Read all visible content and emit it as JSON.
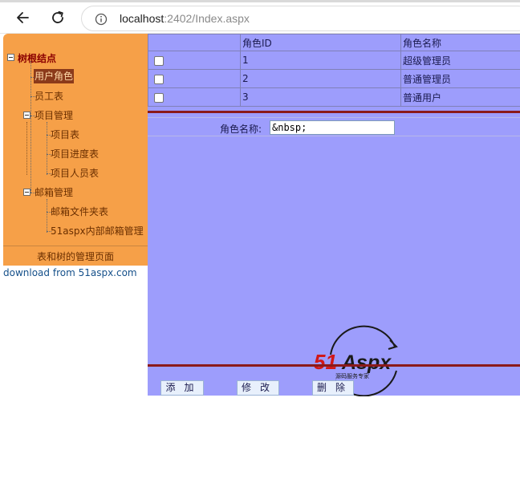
{
  "browser": {
    "url_host": "localhost",
    "url_rest": ":2402/Index.aspx"
  },
  "tree": {
    "root": "树根结点",
    "items": [
      {
        "label": "用户角色"
      },
      {
        "label": "员工表"
      },
      {
        "label": "项目管理"
      },
      {
        "label": "项目表"
      },
      {
        "label": "项目进度表"
      },
      {
        "label": "项目人员表"
      },
      {
        "label": "邮箱管理"
      },
      {
        "label": "邮箱文件夹表"
      },
      {
        "label": "51aspx内部邮箱管理"
      }
    ],
    "selected": "用户角色",
    "caption": "表和树的管理页面"
  },
  "download_text": "download from 51aspx.com",
  "grid": {
    "columns": [
      "",
      "角色ID",
      "角色名称"
    ],
    "rows": [
      {
        "id": "1",
        "name": "超级管理员"
      },
      {
        "id": "2",
        "name": "普通管理员"
      },
      {
        "id": "3",
        "name": "普通用户"
      }
    ]
  },
  "form": {
    "label": "角色名称:",
    "value": "&nbsp;"
  },
  "buttons": {
    "add": "添加",
    "edit": "修改",
    "delete": "删除"
  },
  "logo": {
    "brand": "51Aspx",
    "tagline": "源码服务专家"
  },
  "colors": {
    "tree_bg": "#f6a048",
    "content_bg": "#9d9dfc",
    "divider": "#8b1a1a"
  }
}
